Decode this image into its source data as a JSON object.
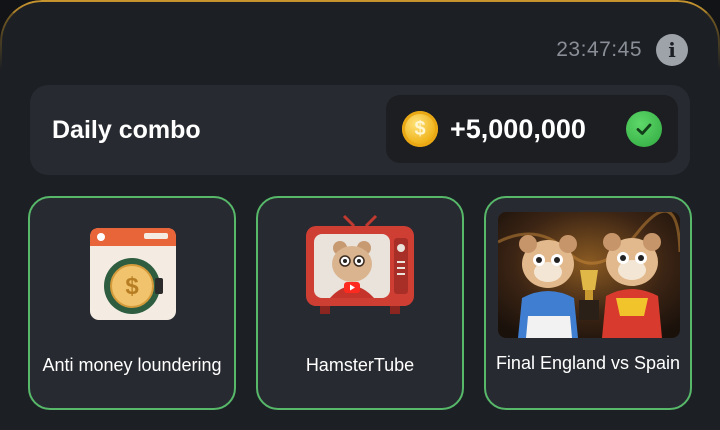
{
  "header": {
    "timer": "23:47:45",
    "info_icon": "info-icon"
  },
  "combo": {
    "title": "Daily combo",
    "reward": "+5,000,000",
    "coin_icon": "coin-icon",
    "status_icon": "check-icon",
    "accent": "#57b86a"
  },
  "cards": [
    {
      "label": "Anti money loundering",
      "icon": "washing-machine-coin-icon"
    },
    {
      "label": "HamsterTube",
      "icon": "hamster-tv-icon"
    },
    {
      "label": "Final England vs Spain",
      "icon": "hamsters-trophy-image"
    }
  ]
}
